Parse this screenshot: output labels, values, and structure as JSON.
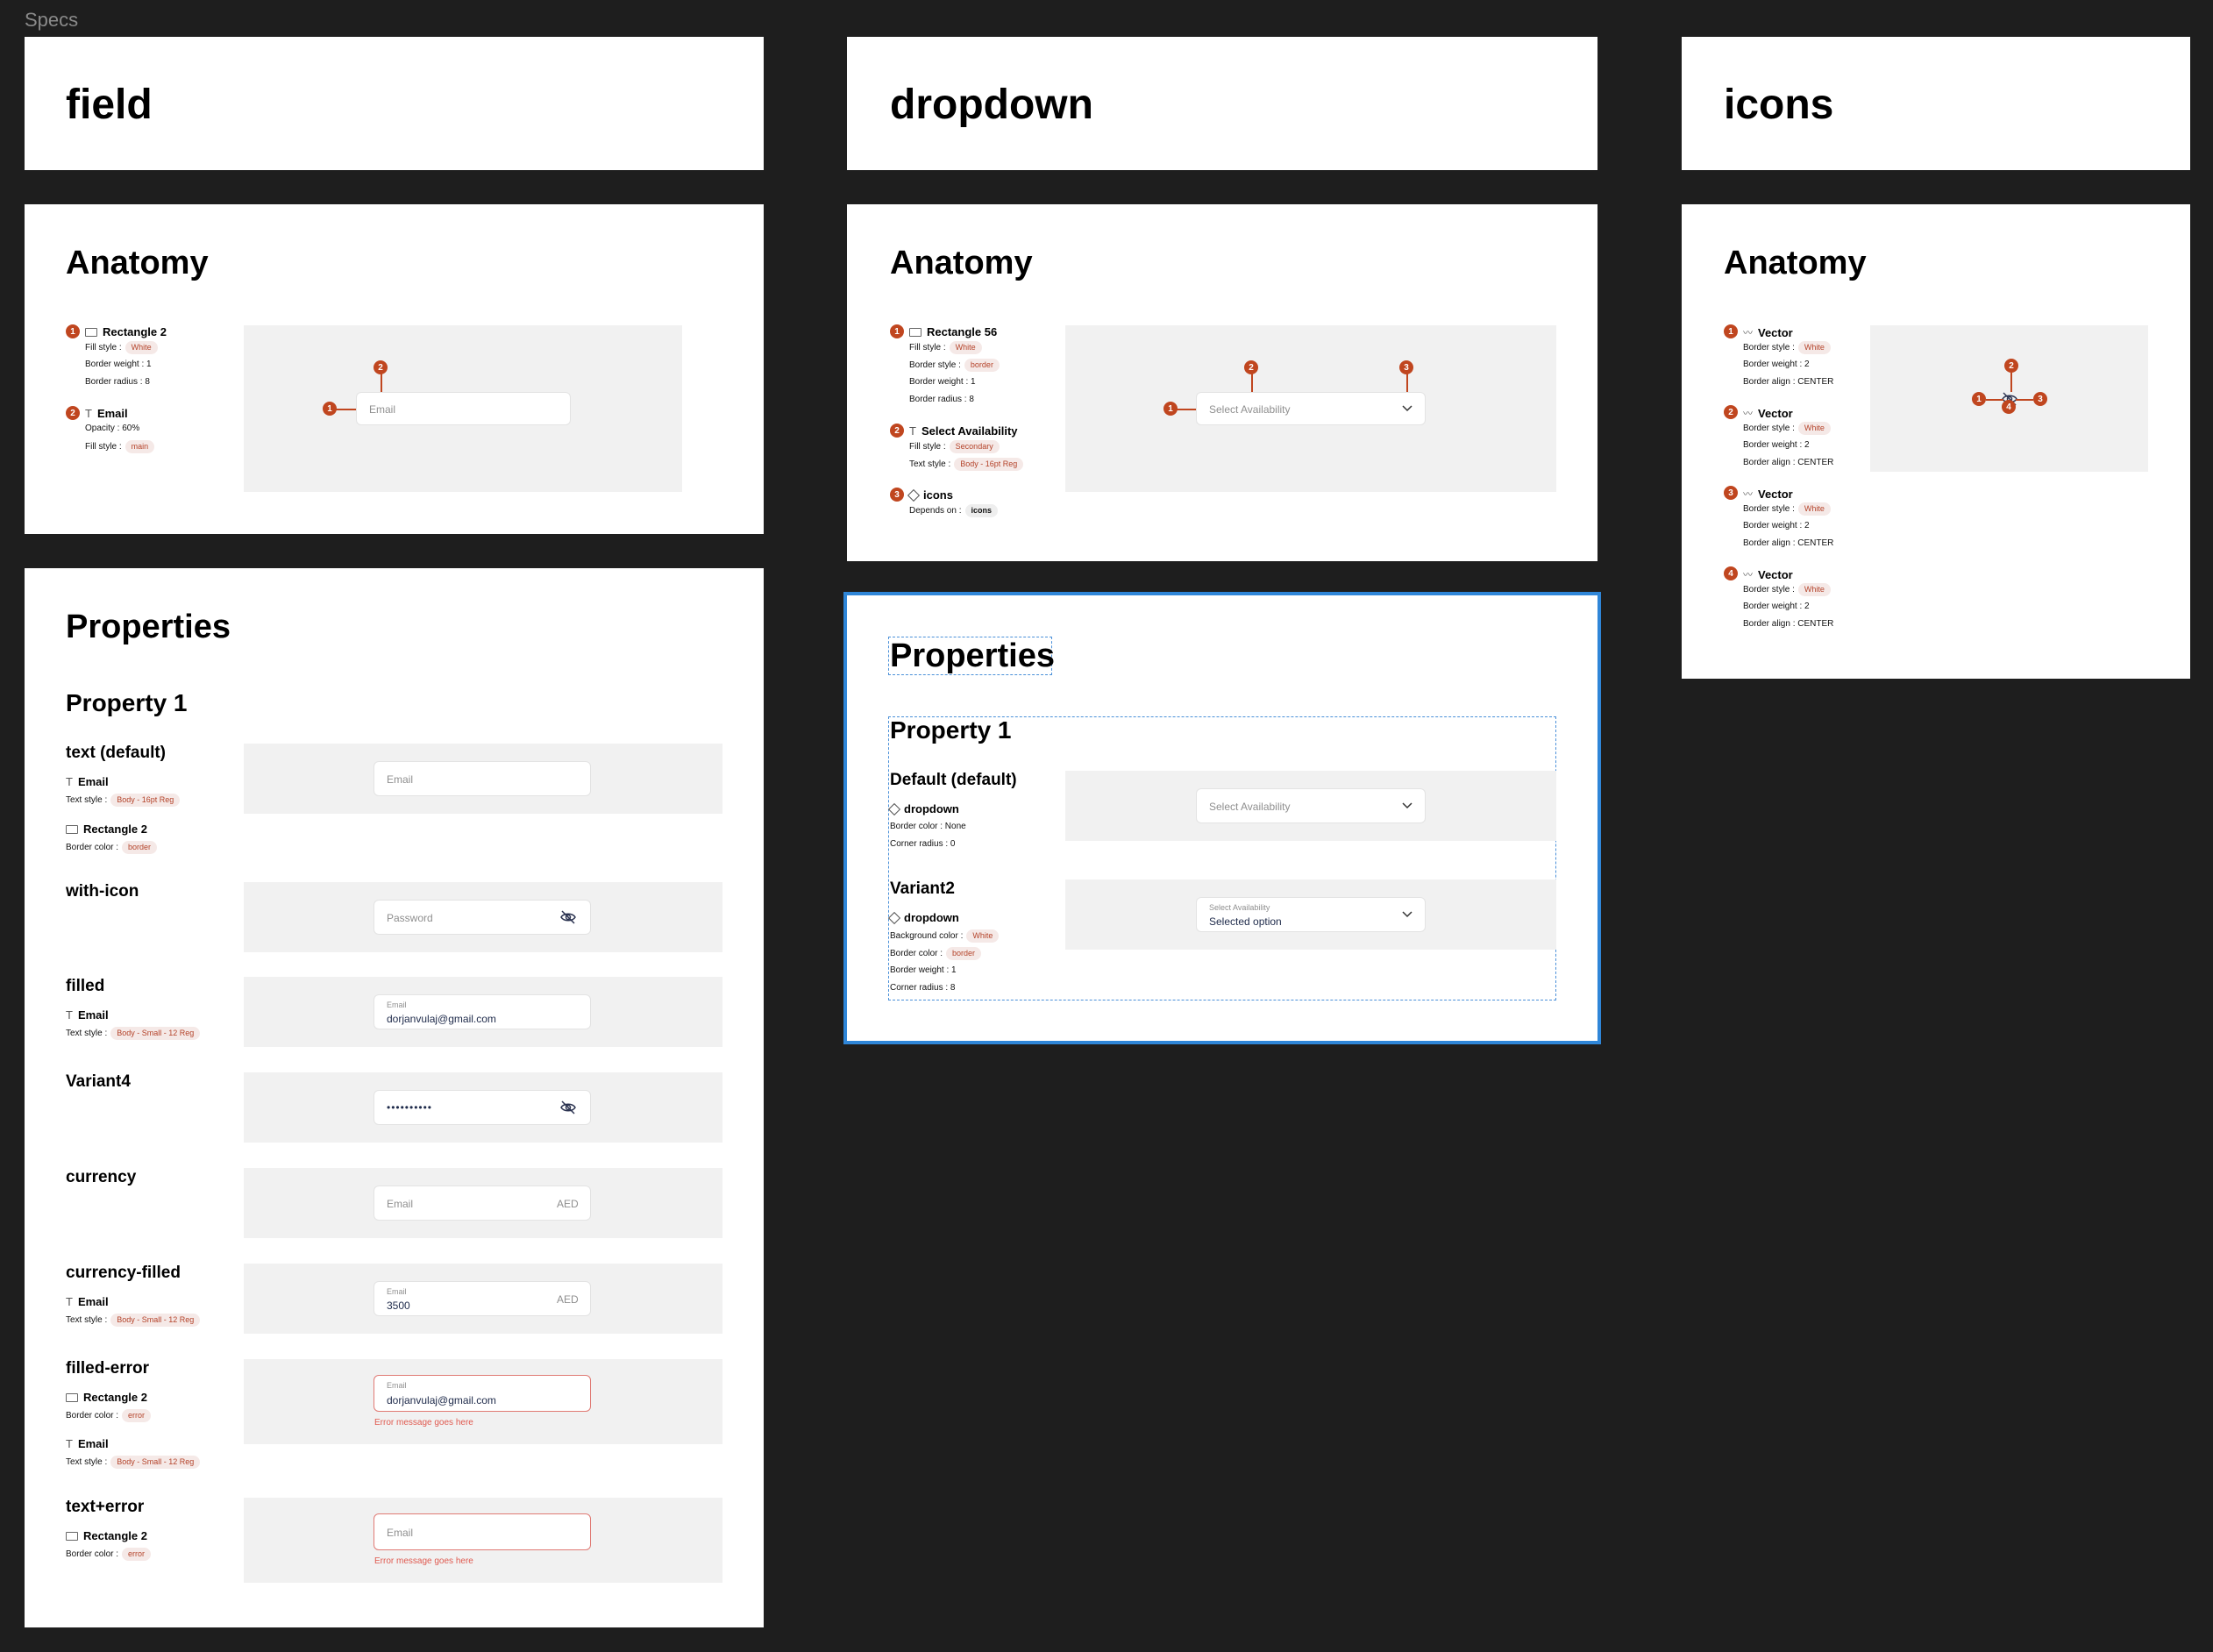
{
  "canvas_label": "Specs",
  "field": {
    "title": "field",
    "anatomy": {
      "heading": "Anatomy",
      "items": [
        {
          "num": "1",
          "name": "Rectangle 2",
          "props": [
            {
              "k": "Fill style :",
              "chip": "White"
            },
            {
              "k": "Border weight : 1"
            },
            {
              "k": "Border radius : 8"
            }
          ]
        },
        {
          "num": "2",
          "name": "Email",
          "props": [
            {
              "k": "Opacity : 60%"
            },
            {
              "k": "Fill style :",
              "chip": "main"
            }
          ]
        }
      ],
      "preview_placeholder": "Email",
      "marker1": "1",
      "marker2": "2"
    },
    "properties": {
      "heading": "Properties",
      "subheading": "Property 1",
      "variants": {
        "text_default": {
          "title": "text (default)",
          "t1": "Email",
          "t1_k": "Text style :",
          "t1_chip": "Body - 16pt Reg",
          "t2": "Rectangle 2",
          "t2_k": "Border color :",
          "t2_chip": "border",
          "placeholder": "Email"
        },
        "with_icon": {
          "title": "with-icon",
          "placeholder": "Password",
          "icon": "eye-off-icon"
        },
        "filled": {
          "title": "filled",
          "t1": "Email",
          "t1_k": "Text style :",
          "t1_chip": "Body - Small - 12 Reg",
          "label": "Email",
          "value": "dorjanvulaj@gmail.com"
        },
        "variant4": {
          "title": "Variant4",
          "value": "••••••••••",
          "icon": "eye-off-icon"
        },
        "currency": {
          "title": "currency",
          "placeholder": "Email",
          "suffix": "AED"
        },
        "currency_filled": {
          "title": "currency-filled",
          "t1": "Email",
          "t1_k": "Text style :",
          "t1_chip": "Body - Small - 12 Reg",
          "label": "Email",
          "value": "3500",
          "suffix": "AED"
        },
        "filled_error": {
          "title": "filled-error",
          "t1": "Rectangle 2",
          "t1_k": "Border color :",
          "t1_chip": "error",
          "t2": "Email",
          "t2_k": "Text style :",
          "t2_chip": "Body - Small - 12 Reg",
          "label": "Email",
          "value": "dorjanvulaj@gmail.com",
          "error": "Error message goes here"
        },
        "text_error": {
          "title": "text+error",
          "t1": "Rectangle 2",
          "t1_k": "Border color :",
          "t1_chip": "error",
          "placeholder": "Email",
          "error": "Error message goes here"
        }
      }
    }
  },
  "dropdown": {
    "title": "dropdown",
    "anatomy": {
      "heading": "Anatomy",
      "items": [
        {
          "num": "1",
          "name": "Rectangle 56",
          "props": [
            {
              "k": "Fill style :",
              "chip": "White"
            },
            {
              "k": "Border style :",
              "chip": "border"
            },
            {
              "k": "Border weight : 1"
            },
            {
              "k": "Border radius : 8"
            }
          ]
        },
        {
          "num": "2",
          "name": "Select Availability",
          "props": [
            {
              "k": "Fill style :",
              "chip": "Secondary"
            },
            {
              "k": "Text style :",
              "chip": "Body - 16pt Reg"
            }
          ]
        },
        {
          "num": "3",
          "name": "icons",
          "props": [
            {
              "k": "Depends on :",
              "chip": "icons"
            }
          ]
        }
      ],
      "preview_placeholder": "Select Availability",
      "marker1": "1",
      "marker2": "2",
      "marker3": "3"
    },
    "properties": {
      "heading": "Properties",
      "subheading": "Property 1",
      "default": {
        "title": "Default (default)",
        "comp": "dropdown",
        "p1": "Border color : None",
        "p2": "Corner radius : 0",
        "placeholder": "Select Availability"
      },
      "variant2": {
        "title": "Variant2",
        "comp": "dropdown",
        "p1_k": "Background color :",
        "p1_chip": "White",
        "p2_k": "Border color :",
        "p2_chip": "border",
        "p3": "Border weight : 1",
        "p4": "Corner radius : 8",
        "label": "Select Availability",
        "value": "Selected option"
      }
    }
  },
  "icons": {
    "title": "icons",
    "anatomy": {
      "heading": "Anatomy",
      "items": [
        {
          "num": "1",
          "name": "Vector",
          "props": [
            {
              "k": "Border style :",
              "chip": "White"
            },
            {
              "k": "Border weight : 2"
            },
            {
              "k": "Border align : CENTER"
            }
          ]
        },
        {
          "num": "2",
          "name": "Vector",
          "props": [
            {
              "k": "Border style :",
              "chip": "White"
            },
            {
              "k": "Border weight : 2"
            },
            {
              "k": "Border align : CENTER"
            }
          ]
        },
        {
          "num": "3",
          "name": "Vector",
          "props": [
            {
              "k": "Border style :",
              "chip": "White"
            },
            {
              "k": "Border weight : 2"
            },
            {
              "k": "Border align : CENTER"
            }
          ]
        },
        {
          "num": "4",
          "name": "Vector",
          "props": [
            {
              "k": "Border style :",
              "chip": "White"
            },
            {
              "k": "Border weight : 2"
            },
            {
              "k": "Border align : CENTER"
            }
          ]
        }
      ],
      "marker1": "1",
      "marker2": "2",
      "marker3": "3",
      "marker4": "4"
    }
  },
  "colors": {
    "canvas": "#1e1e1e",
    "marker": "#c0461f",
    "selection": "#2f86d8",
    "error": "#e05a50"
  }
}
